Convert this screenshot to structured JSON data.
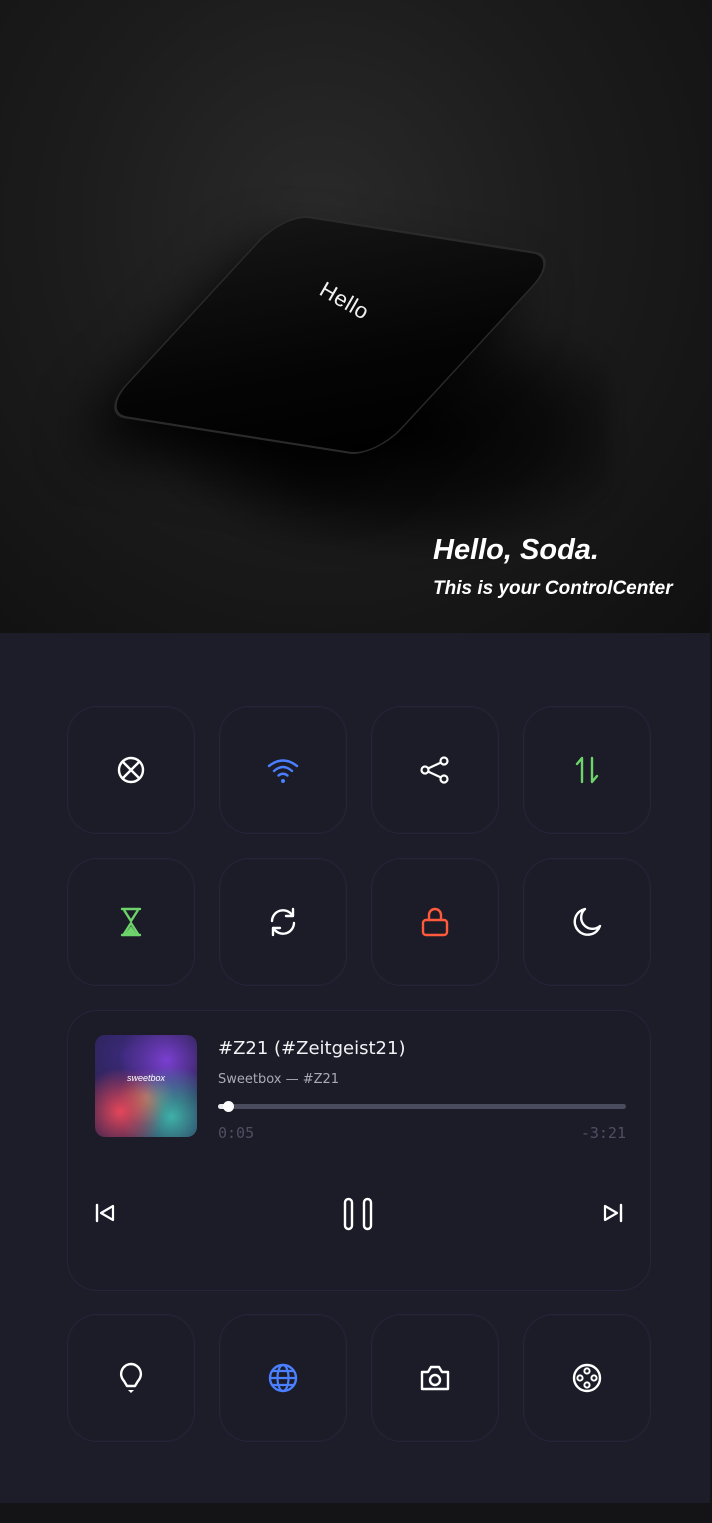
{
  "hero": {
    "phone_text": "Hello",
    "title": "Hello, Soda.",
    "subtitle": "This is your ControlCenter"
  },
  "tiles_row1": [
    {
      "icon": "airplane-mode-off-icon",
      "color": "#ffffff"
    },
    {
      "icon": "wifi-icon",
      "color": "#4a7fff"
    },
    {
      "icon": "share-icon",
      "color": "#ffffff"
    },
    {
      "icon": "data-transfer-icon",
      "color": "#6dd36a"
    }
  ],
  "tiles_row2": [
    {
      "icon": "hourglass-icon",
      "color": "#6dd36a"
    },
    {
      "icon": "sync-icon",
      "color": "#ffffff"
    },
    {
      "icon": "lock-icon",
      "color": "#ff5a3c"
    },
    {
      "icon": "moon-icon",
      "color": "#ffffff"
    }
  ],
  "media": {
    "album_art_text": "sweetbox",
    "title": "#Z21 (#Zeitgeist21)",
    "artist": "Sweetbox — #Z21",
    "elapsed": "0:05",
    "remaining": "-3:21",
    "progress": 0.025,
    "prev_icon": "skip-previous-icon",
    "pause_icon": "pause-icon",
    "next_icon": "skip-next-icon"
  },
  "tiles_row3": [
    {
      "icon": "lightbulb-icon",
      "color": "#ffffff"
    },
    {
      "icon": "globe-icon",
      "color": "#4a7fff"
    },
    {
      "icon": "camera-icon",
      "color": "#ffffff"
    },
    {
      "icon": "film-reel-icon",
      "color": "#ffffff"
    }
  ],
  "colors": {
    "background": "#1c1d29",
    "tile": "#1b1c28",
    "accent_blue": "#4a7fff",
    "accent_green": "#6dd36a",
    "accent_red": "#ff5a3c"
  }
}
